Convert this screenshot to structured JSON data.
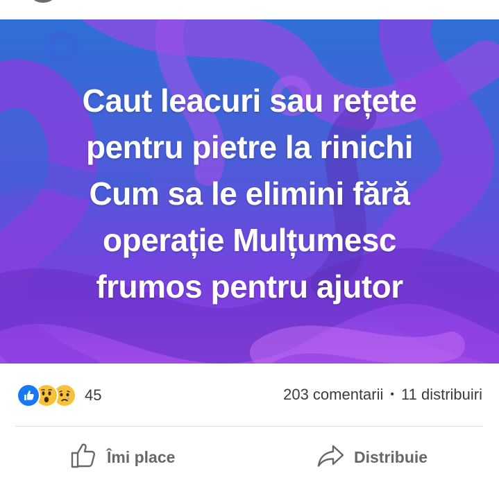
{
  "post": {
    "lines": [
      "Caut leacuri sau rețete",
      "pentru pietre la rinichi",
      "Cum sa le elimini fără",
      "operație Mulțumesc",
      "frumos pentru ajutor"
    ],
    "background_colors": [
      "#2f6fd6",
      "#7b3fe0",
      "#a04be6"
    ]
  },
  "reactions": {
    "icons": [
      "like-icon",
      "wow-icon",
      "sad-icon"
    ],
    "count": "45"
  },
  "stats": {
    "comments": "203 comentarii",
    "separator": "•",
    "shares": "11 distribuiri"
  },
  "actions": {
    "like_label": "Îmi place",
    "share_label": "Distribuie"
  },
  "colors": {
    "like_blue": "#1877f2",
    "reaction_yellow": "#f7c23a",
    "secondary_text": "#65676b"
  }
}
